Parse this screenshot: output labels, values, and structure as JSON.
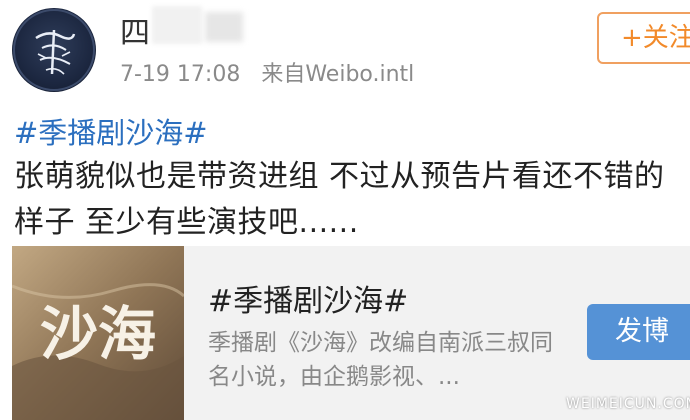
{
  "header": {
    "username": "四",
    "timestamp": "7-19 17:08",
    "source": "来自Weibo.intl",
    "follow_label": "+关注"
  },
  "post": {
    "hashtag": "#季播剧沙海#",
    "text": "张萌貌似也是带资进组 不过从预告片看还不错的样子 至少有些演技吧......"
  },
  "card": {
    "image_text": "沙海",
    "title": "#季播剧沙海#",
    "description": "季播剧《沙海》改编自南派三叔同名小说，由企鹅影视、...",
    "button_label": "发博"
  },
  "watermark": "WEIMEICUN.COM",
  "colors": {
    "link": "#2b6fbf",
    "follow": "#f28a2a",
    "button": "#5592d6"
  }
}
